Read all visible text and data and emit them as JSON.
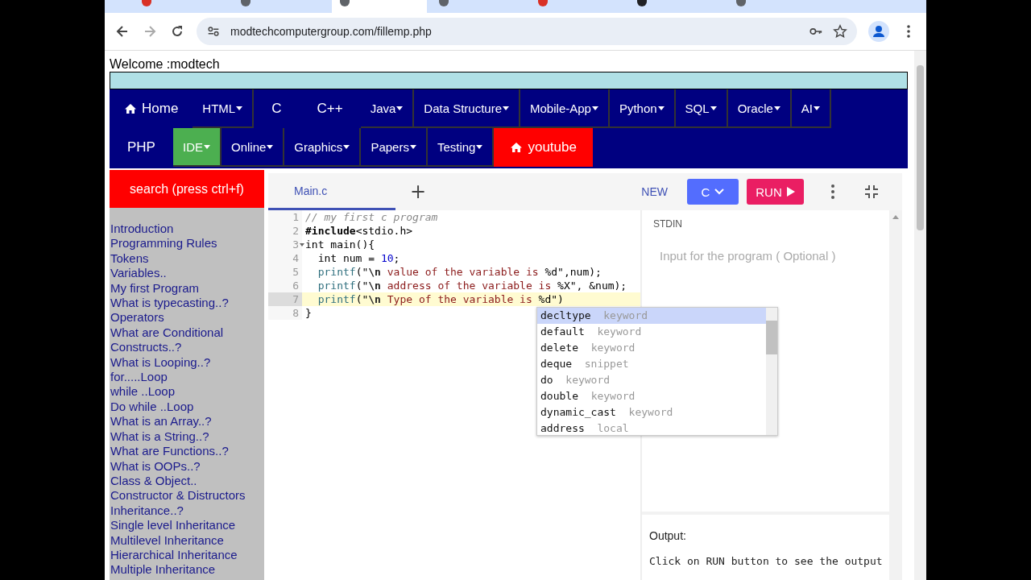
{
  "browser": {
    "tabs": [
      {
        "color": "#d93025",
        "selected": false
      },
      {
        "color": "#5f6368",
        "selected": false
      },
      {
        "color": "#5f6368",
        "selected": true
      },
      {
        "color": "#5f6368",
        "selected": false
      },
      {
        "color": "#d93025",
        "selected": false
      },
      {
        "color": "#202124",
        "selected": false
      },
      {
        "color": "#5f6368",
        "selected": false
      }
    ],
    "url": "modtechcomputergroup.com/fillemp.php"
  },
  "welcome": "Welcome :modtech",
  "nav_rows": [
    [
      {
        "label": "Home",
        "kind": "home",
        "color": "#000080"
      },
      {
        "label": "HTML",
        "kind": "dropdown",
        "color": "#000080"
      },
      {
        "label": "C",
        "kind": "plain",
        "color": "#000080"
      },
      {
        "label": "C++",
        "kind": "plain",
        "color": "#000080"
      },
      {
        "label": "Java",
        "kind": "dropdown",
        "color": "#000080"
      },
      {
        "label": "Data Structure",
        "kind": "dropdown",
        "color": "#000080"
      },
      {
        "label": "Mobile-App",
        "kind": "dropdown",
        "color": "#000080"
      },
      {
        "label": "Python",
        "kind": "dropdown",
        "color": "#000080"
      },
      {
        "label": "SQL",
        "kind": "dropdown",
        "color": "#000080"
      },
      {
        "label": "Oracle",
        "kind": "dropdown",
        "color": "#000080"
      },
      {
        "label": "AI",
        "kind": "dropdown",
        "color": "#000080"
      }
    ],
    [
      {
        "label": "PHP",
        "kind": "plain",
        "color": "#000080"
      },
      {
        "label": "IDE",
        "kind": "dropdown",
        "color": "#4caf50"
      },
      {
        "label": "Online",
        "kind": "dropdown",
        "color": "#000080"
      },
      {
        "label": "Graphics",
        "kind": "dropdown",
        "color": "#000080"
      },
      {
        "label": "Papers",
        "kind": "dropdown",
        "color": "#000080"
      },
      {
        "label": "Testing",
        "kind": "dropdown",
        "color": "#000080"
      },
      {
        "label": "youtube",
        "kind": "iconlink",
        "color": "#ff0000"
      }
    ]
  ],
  "search_button": "search (press ctrl+f)",
  "sidebar": {
    "items": [
      "Introduction",
      "Programming Rules",
      "Tokens",
      "Variables..",
      "My first Program",
      "What is typecasting..?",
      "Operators",
      "What are Conditional Constructs..?",
      "What is Looping..?",
      "for.....Loop",
      "while ..Loop",
      "Do while ..Loop",
      "What is an Array..?",
      "What is a String..?",
      "What are Functions..?",
      "What is OOPs..?",
      "Class & Object..",
      "Constructor & Distructors",
      "Inheritance..?",
      "Single level Inheritance",
      "Multilevel Inheritance",
      "Hierarchical Inheritance",
      "Multiple Inheritance"
    ]
  },
  "editor": {
    "file_tab": "Main.c",
    "add_tab": "+",
    "new_button": "NEW",
    "language": "C",
    "run_button": "RUN",
    "lines": [
      {
        "number": "1",
        "active": false,
        "fold": false,
        "tokens": [
          {
            "kind": "comment",
            "text": "// my first c program"
          }
        ]
      },
      {
        "number": "2",
        "active": false,
        "fold": false,
        "tokens": [
          {
            "kind": "directive",
            "text": "#include"
          },
          {
            "kind": "plain",
            "text": "<stdio.h>"
          }
        ]
      },
      {
        "number": "3",
        "active": false,
        "fold": true,
        "tokens": [
          {
            "kind": "plain",
            "text": "int main(){"
          }
        ]
      },
      {
        "number": "4",
        "active": false,
        "fold": false,
        "tokens": [
          {
            "kind": "plain",
            "text": "  int num = "
          },
          {
            "kind": "number",
            "text": "10"
          },
          {
            "kind": "plain",
            "text": ";"
          }
        ]
      },
      {
        "number": "5",
        "active": false,
        "fold": false,
        "tokens": [
          {
            "kind": "func",
            "text": "  printf"
          },
          {
            "kind": "plain",
            "text": "(\""
          },
          {
            "kind": "escape",
            "text": "\\n"
          },
          {
            "kind": "string",
            "text": " value of the variable is "
          },
          {
            "kind": "plain",
            "text": "%d\",num);"
          }
        ]
      },
      {
        "number": "6",
        "active": false,
        "fold": false,
        "tokens": [
          {
            "kind": "func",
            "text": "  printf"
          },
          {
            "kind": "plain",
            "text": "(\""
          },
          {
            "kind": "escape",
            "text": "\\n"
          },
          {
            "kind": "string",
            "text": " address of the variable is "
          },
          {
            "kind": "plain",
            "text": "%X\", &num);"
          }
        ]
      },
      {
        "number": "7",
        "active": true,
        "fold": false,
        "tokens": [
          {
            "kind": "func",
            "text": "  printf"
          },
          {
            "kind": "plain",
            "text": "(\""
          },
          {
            "kind": "escape",
            "text": "\\n"
          },
          {
            "kind": "string",
            "text": " Type of the variable is "
          },
          {
            "kind": "plain",
            "text": "%d\")"
          }
        ]
      },
      {
        "number": "8",
        "active": false,
        "fold": false,
        "tokens": [
          {
            "kind": "plain",
            "text": "}"
          }
        ]
      }
    ],
    "autocomplete": [
      {
        "name": "decltype",
        "type": "keyword",
        "selected": true
      },
      {
        "name": "default",
        "type": "keyword",
        "selected": false
      },
      {
        "name": "delete",
        "type": "keyword",
        "selected": false
      },
      {
        "name": "deque",
        "type": "snippet",
        "selected": false
      },
      {
        "name": "do",
        "type": "keyword",
        "selected": false
      },
      {
        "name": "double",
        "type": "keyword",
        "selected": false
      },
      {
        "name": "dynamic_cast",
        "type": "keyword",
        "selected": false
      },
      {
        "name": "address",
        "type": "local",
        "selected": false
      }
    ],
    "stdin_label": "STDIN",
    "stdin_placeholder": "Input for the program ( Optional )",
    "output_label": "Output:",
    "output_text": "Click on RUN button to see the output"
  }
}
